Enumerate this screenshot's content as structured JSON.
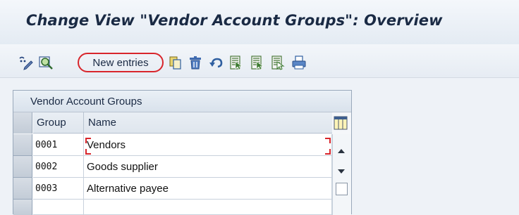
{
  "window": {
    "title": "Change View \"Vendor Account Groups\": Overview"
  },
  "toolbar": {
    "new_entries_label": "New entries",
    "icons": [
      "display-change-icon",
      "find-icon",
      "copy-icon",
      "delete-icon",
      "undo-icon",
      "select-all-icon",
      "select-block-icon",
      "deselect-all-icon",
      "print-icon"
    ],
    "highlight_color": "#d8262c"
  },
  "table": {
    "title": "Vendor Account Groups",
    "columns": [
      "Group",
      "Name"
    ],
    "rows": [
      {
        "group": "0001",
        "name": "Vendors"
      },
      {
        "group": "0002",
        "name": "Goods supplier"
      },
      {
        "group": "0003",
        "name": "Alternative payee"
      }
    ],
    "config_icon": "table-settings-icon",
    "cursor_cell": "name"
  },
  "colors": {
    "background": "#eef2f7",
    "text": "#1a2a44",
    "border": "#9aa9bb"
  }
}
